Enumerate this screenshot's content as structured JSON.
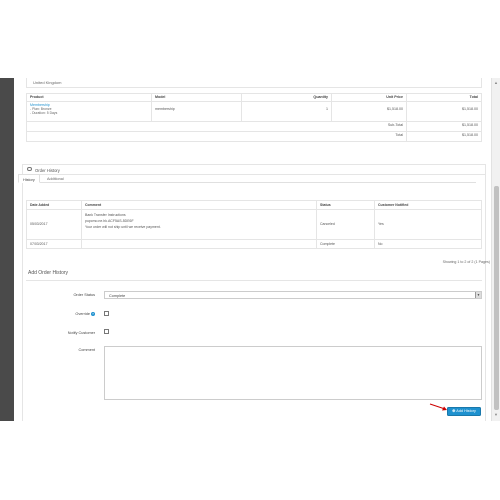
{
  "address": {
    "country": "United Kingdom"
  },
  "products": {
    "headers": [
      "Product",
      "Model",
      "Quantity",
      "Unit Price",
      "Total"
    ],
    "items": [
      {
        "name": "Membership",
        "options": [
          "- Plan: Bronze",
          "- Duration: 5 Days"
        ],
        "model": "membership",
        "quantity": "1",
        "unit_price": "$1,518.00",
        "total": "$1,518.00"
      }
    ],
    "totals": [
      {
        "label": "Sub-Total",
        "value": "$1,518.00"
      },
      {
        "label": "Total",
        "value": "$1,518.00"
      }
    ]
  },
  "history_panel": {
    "title": "Order History",
    "tabs": [
      {
        "label": "History",
        "active": true
      },
      {
        "label": "Additional",
        "active": false
      }
    ]
  },
  "history_table": {
    "headers": [
      "Date Added",
      "Comment",
      "Status",
      "Customer Notified"
    ],
    "rows": [
      {
        "date": "05/03/2017",
        "comment_lines": [
          "Bank Transfer Instructions",
          "pupcmo.ne.hk.ACF5AS-5DE6F",
          "Your order will not ship until we receive payment."
        ],
        "status": "Canceled",
        "notified": "Yes"
      },
      {
        "date": "07/03/2017",
        "comment_lines": [
          ""
        ],
        "status": "Complete",
        "notified": "No"
      }
    ]
  },
  "pagination": {
    "text": "Showing 1 to 2 of 2 (1 Pages)"
  },
  "add_history": {
    "title": "Add Order History",
    "order_status_label": "Order Status",
    "order_status_value": "Complete",
    "override_label": "Override",
    "notify_label": "Notify Customer",
    "comment_label": "Comment",
    "button_label": "Add History"
  },
  "colors": {
    "accent": "#1e91cf",
    "arrow": "#cc0000",
    "sidebar": "#4a4a4a"
  }
}
